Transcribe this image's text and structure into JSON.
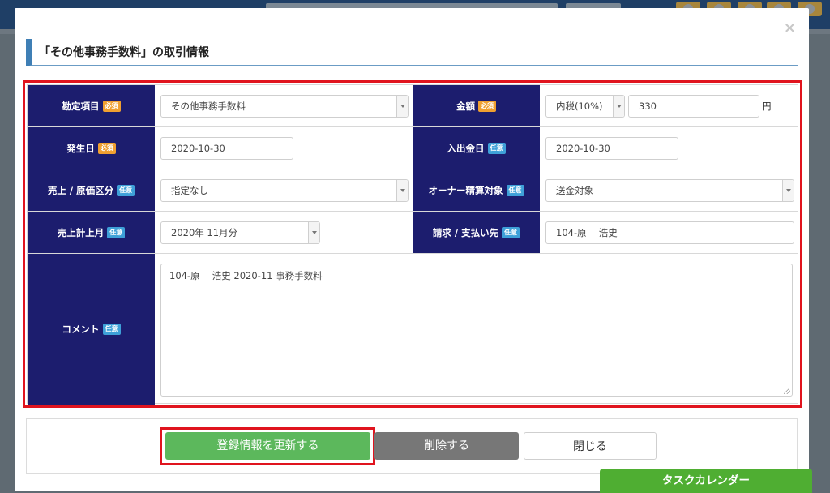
{
  "modal": {
    "title": "「その他事務手数料」の取引情報",
    "close_glyph": "×"
  },
  "badges": {
    "required": "必須",
    "optional": "任意"
  },
  "form": {
    "account_item": {
      "label": "勘定項目",
      "value": "その他事務手数料"
    },
    "amount": {
      "label": "金額",
      "tax_select": "内税(10%)",
      "value": "330",
      "unit": "円"
    },
    "occurrence_date": {
      "label": "発生日",
      "value": "2020-10-30"
    },
    "payment_date": {
      "label": "入出金日",
      "value": "2020-10-30"
    },
    "sales_cost_class": {
      "label": "売上 / 原価区分",
      "value": "指定なし"
    },
    "owner_settlement": {
      "label": "オーナー精算対象",
      "value": "送金対象"
    },
    "sales_month": {
      "label": "売上計上月",
      "value": "2020年 11月分"
    },
    "billing_payee": {
      "label": "請求 / 支払い先",
      "value": "104-原　 浩史"
    },
    "comment": {
      "label": "コメント",
      "value": "104-原　 浩史 2020-11 事務手数料"
    }
  },
  "buttons": {
    "update": "登録情報を更新する",
    "delete": "削除する",
    "close": "閉じる"
  },
  "task_calendar": "タスクカレンダー",
  "colors": {
    "label_bg": "#1c1d6e",
    "required_badge": "#f0a030",
    "optional_badge": "#3ea0d8",
    "update_button": "#5cb85c",
    "delete_button": "#777777",
    "highlight": "#e0141e",
    "task_calendar": "#4fae32"
  }
}
